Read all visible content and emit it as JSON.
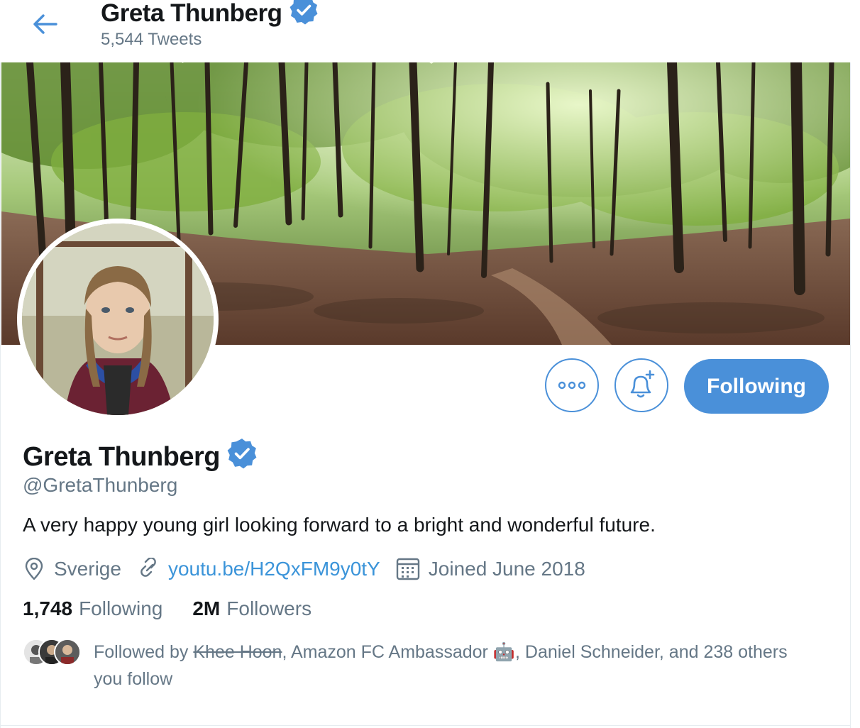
{
  "header": {
    "back_label": "Back",
    "name": "Greta Thunberg",
    "tweets_count": "5,544 Tweets"
  },
  "profile": {
    "name": "Greta Thunberg",
    "handle": "@GretaThunberg",
    "bio": "A very happy young girl looking forward to a bright and wonderful future.",
    "location": "Sverige",
    "website": "youtu.be/H2QxFM9y0tY",
    "joined": "Joined June 2018",
    "verified": true
  },
  "actions": {
    "more_icon": "more-horizontal-icon",
    "notify_icon": "bell-plus-icon",
    "following_label": "Following"
  },
  "stats": {
    "following_count": "1,748",
    "following_label": "Following",
    "followers_count": "2M",
    "followers_label": "Followers"
  },
  "followed_by": {
    "prefix": "Followed by ",
    "name1": "Khee Hoon",
    "sep1": ", ",
    "name2": "Amazon FC Ambassador",
    "emoji": "🤖",
    "sep2": ", ",
    "name3": "Daniel Schneider",
    "suffix": ", and 238 others you follow"
  },
  "colors": {
    "accent": "#4a90d9",
    "link": "#3b94d9",
    "secondary_text": "#657786",
    "primary_text": "#14171a"
  }
}
